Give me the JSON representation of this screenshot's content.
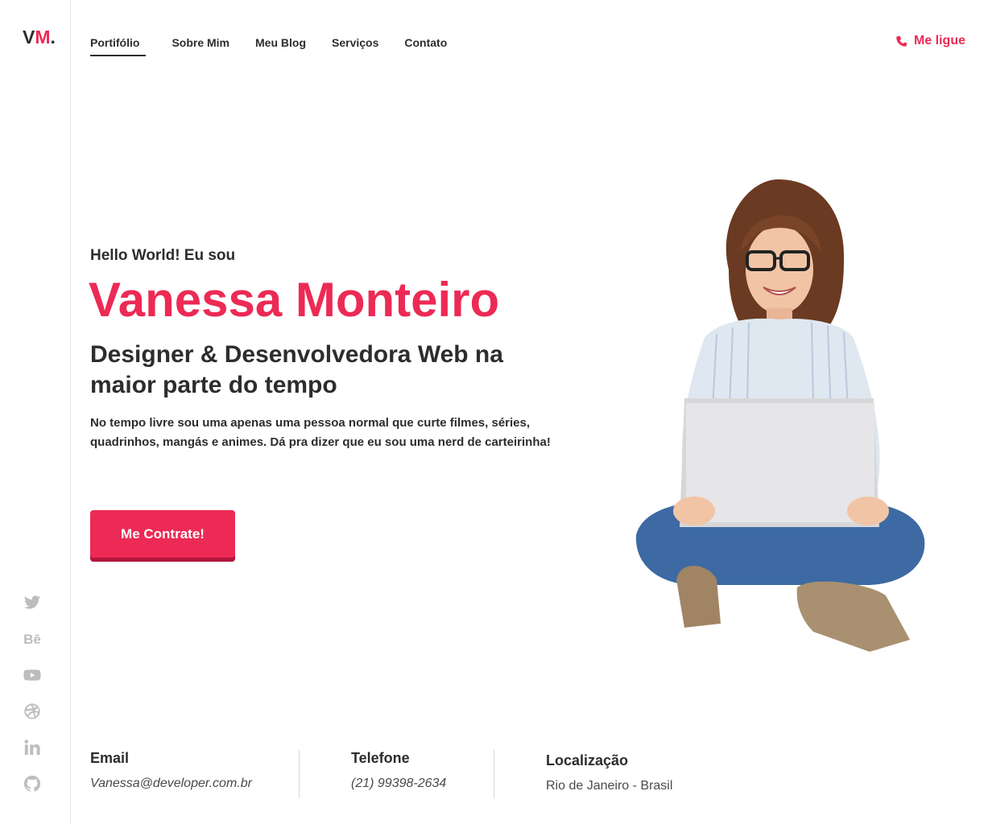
{
  "logo": {
    "v": "V",
    "m": "M",
    "dot": "."
  },
  "nav": {
    "items": [
      "Portifólio",
      "Sobre Mim",
      "Meu Blog",
      "Serviços",
      "Contato"
    ],
    "active": "Portifólio"
  },
  "call": {
    "label": "Me ligue",
    "icon": "phone-icon"
  },
  "hero": {
    "greeting": "Hello World! Eu sou",
    "name": "Vanessa Monteiro",
    "role": "Designer & Desenvolvedora Web na maior parte do tempo",
    "description": "No tempo livre sou uma apenas uma pessoa normal que curte filmes, séries, quadrinhos, mangás e animes. Dá pra dizer que eu sou uma nerd de carteirinha!",
    "cta": "Me Contrate!"
  },
  "social": {
    "icons": [
      "twitter-icon",
      "behance-icon",
      "youtube-icon",
      "dribbble-icon",
      "linkedin-icon",
      "github-icon"
    ],
    "behance_text": "Bē"
  },
  "contact": {
    "email_label": "Email",
    "email": "Vanessa@developer.com.br",
    "phone_label": "Telefone",
    "phone": "(21) 99398-2634",
    "location_label": "Localização",
    "location": "Rio de Janeiro - Brasil"
  },
  "colors": {
    "accent": "#ec2a55",
    "text": "#2d2d2d",
    "muted": "#bdbdbd"
  }
}
